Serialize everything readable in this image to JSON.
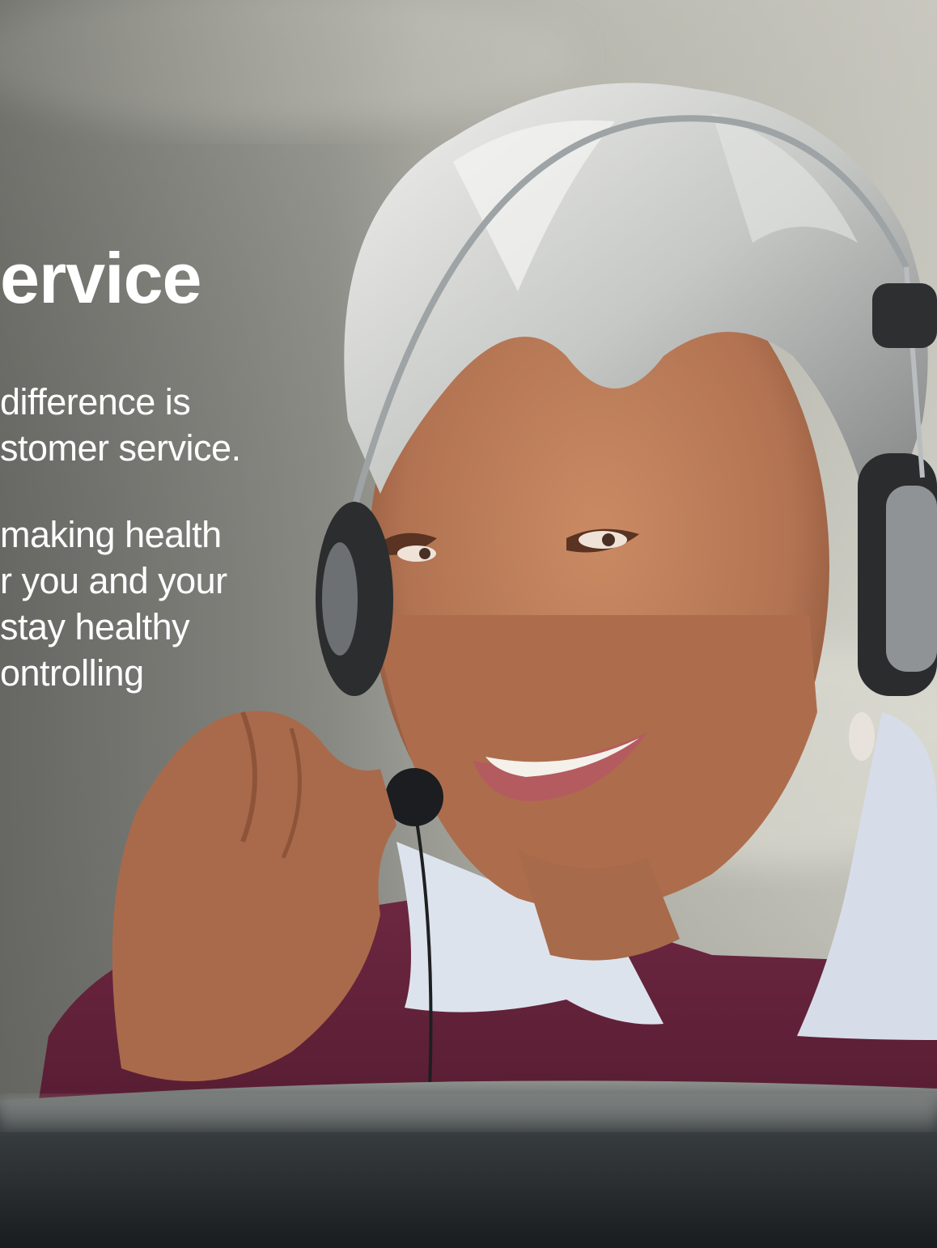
{
  "headline": "ervice",
  "paragraph_1": [
    "difference is",
    "stomer service."
  ],
  "paragraph_2": [
    "making health",
    "r you and your",
    "stay healthy",
    "ontrolling"
  ],
  "colors": {
    "text": "#ffffff",
    "backdrop": "#7c7d77",
    "sweater": "#5e1f35",
    "shirt": "#dfe6f0",
    "hair": "#d7d9d8",
    "skin": "#b77a57",
    "monitor": "#23272b"
  }
}
